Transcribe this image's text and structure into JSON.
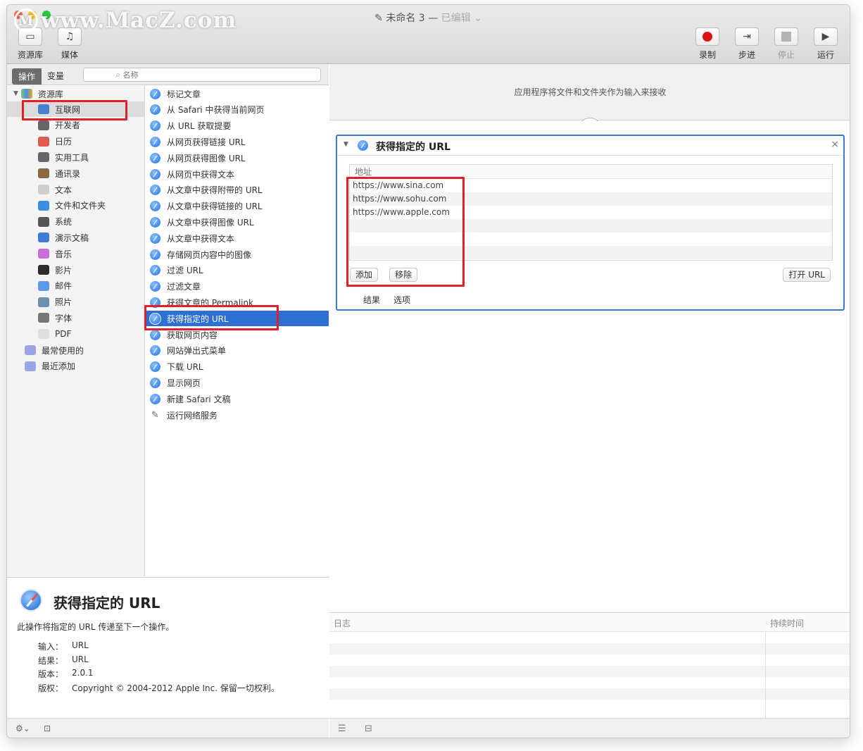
{
  "watermark": {
    "logo": "M",
    "text": "www.MacZ.com"
  },
  "window": {
    "title": "未命名 3",
    "title_sep": " — ",
    "status": "已编辑",
    "title_icon": "wand-icon"
  },
  "toolbar": {
    "left": [
      {
        "label": "资源库",
        "icon": "library-icon"
      },
      {
        "label": "媒体",
        "icon": "media-icon"
      }
    ],
    "right": [
      {
        "label": "录制",
        "icon": "record-icon"
      },
      {
        "label": "步进",
        "icon": "step-icon"
      },
      {
        "label": "停止",
        "icon": "stop-icon"
      },
      {
        "label": "运行",
        "icon": "run-icon"
      }
    ]
  },
  "search": {
    "tab_actions": "操作",
    "tab_variables": "变量",
    "placeholder": "名称"
  },
  "library": {
    "root": "资源库",
    "items": [
      {
        "label": "互联网",
        "icon": "globe-icon",
        "color": "#4a7fd0"
      },
      {
        "label": "开发者",
        "icon": "tools-icon",
        "color": "#666666"
      },
      {
        "label": "日历",
        "icon": "calendar-icon",
        "color": "#e05a4f"
      },
      {
        "label": "实用工具",
        "icon": "utilities-icon",
        "color": "#666666"
      },
      {
        "label": "通讯录",
        "icon": "contacts-icon",
        "color": "#8a6a3e"
      },
      {
        "label": "文本",
        "icon": "text-icon",
        "color": "#cfcfcf"
      },
      {
        "label": "文件和文件夹",
        "icon": "finder-icon",
        "color": "#3a8ee0"
      },
      {
        "label": "系统",
        "icon": "system-icon",
        "color": "#555555"
      },
      {
        "label": "演示文稿",
        "icon": "keynote-icon",
        "color": "#3f7ad6"
      },
      {
        "label": "音乐",
        "icon": "music-icon",
        "color": "#c76fd6"
      },
      {
        "label": "影片",
        "icon": "quicktime-icon",
        "color": "#2b2b2b"
      },
      {
        "label": "邮件",
        "icon": "mail-icon",
        "color": "#5a9ae6"
      },
      {
        "label": "照片",
        "icon": "photos-icon",
        "color": "#6f8fb0"
      },
      {
        "label": "字体",
        "icon": "font-icon",
        "color": "#777777"
      },
      {
        "label": "PDF",
        "icon": "pdf-icon",
        "color": "#dddddd"
      }
    ],
    "smart": [
      {
        "label": "最常使用的",
        "icon": "smart-folder-icon",
        "color": "#9aa6e8"
      },
      {
        "label": "最近添加",
        "icon": "smart-folder-icon",
        "color": "#9aa6e8"
      }
    ]
  },
  "actions": [
    "标记文章",
    "从 Safari 中获得当前网页",
    "从 URL 获取提要",
    "从网页获得链接 URL",
    "从网页获得图像 URL",
    "从网页中获得文本",
    "从文章中获得附带的 URL",
    "从文章中获得链接的 URL",
    "从文章中获得图像 URL",
    "从文章中获得文本",
    "存储网页内容中的图像",
    "过滤 URL",
    "过滤文章",
    "获得文章的 Permalink",
    "获得指定的 URL",
    "获取网页内容",
    "网站弹出式菜单",
    "下载 URL",
    "显示网页",
    "新建 Safari 文稿",
    "运行网络服务"
  ],
  "description": {
    "title": "获得指定的 URL",
    "text": "此操作将指定的 URL 传递至下一个操作。",
    "fields": [
      {
        "key": "输入：",
        "value": "URL"
      },
      {
        "key": "结果：",
        "value": "URL"
      },
      {
        "key": "版本：",
        "value": "2.0.1"
      },
      {
        "key": "版权：",
        "value": "Copyright © 2004-2012 Apple Inc. 保留一切权利。"
      }
    ]
  },
  "workflow": {
    "hint": "应用程序将文件和文件夹作为输入来接收",
    "card": {
      "title": "获得指定的 URL",
      "column": "地址",
      "urls": [
        "https://www.sina.com",
        "https://www.sohu.com",
        "https://www.apple.com"
      ],
      "add": "添加",
      "remove": "移除",
      "open": "打开 URL",
      "tab_results": "结果",
      "tab_options": "选项"
    }
  },
  "log": {
    "col_log": "日志",
    "col_duration": "持续时间"
  },
  "accent": "#2d6fd2",
  "highlight": "#e3202a"
}
